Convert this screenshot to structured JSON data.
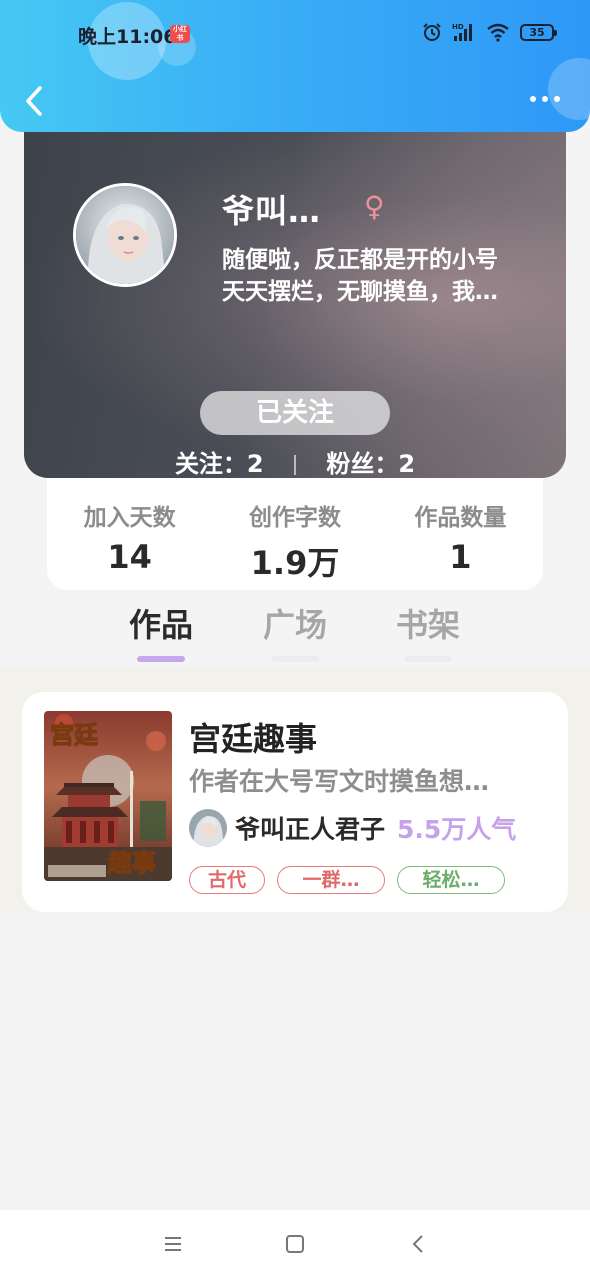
{
  "status_bar": {
    "time": "晚上11:06",
    "app_badge": "小红书",
    "battery": "35",
    "icons": [
      "alarm-icon",
      "signal-icon",
      "wifi-icon",
      "battery-icon"
    ]
  },
  "nav": {
    "back_icon": "chevron-left-icon",
    "more_icon": "more-horizontal-icon"
  },
  "profile": {
    "name": "爷叫…",
    "gender_symbol": "♀",
    "bio_line1": "随便啦，反正都是开的小号",
    "bio_line2": "天天摆烂，无聊摸鱼，我…",
    "follow_button": "已关注",
    "following_label": "关注：2",
    "followers_label": "粉丝：2"
  },
  "stats": [
    {
      "label": "加入天数",
      "value": "14"
    },
    {
      "label": "创作字数",
      "value": "1.9万"
    },
    {
      "label": "作品数量",
      "value": "1"
    }
  ],
  "tabs": [
    {
      "label": "作品",
      "active": true
    },
    {
      "label": "广场",
      "active": false
    },
    {
      "label": "书架",
      "active": false
    }
  ],
  "works": [
    {
      "title": "宫廷趣事",
      "description": "作者在大号写文时摸鱼想…",
      "author": "爷叫正人君子",
      "popularity": "5.5万人气",
      "cover_text_top": "宫廷",
      "cover_text_bottom": "趣事",
      "tags": [
        {
          "label": "古代",
          "color": "red"
        },
        {
          "label": "一群…",
          "color": "red"
        },
        {
          "label": "轻松…",
          "color": "green"
        }
      ]
    }
  ],
  "colors": {
    "header_gradient_start": "#45c9f3",
    "header_gradient_end": "#2e98f7",
    "tab_indicator": "#c7a7ec",
    "popularity": "#c6a2ea",
    "tag_red": "#e06a6a",
    "tag_green": "#6aae6a"
  },
  "system_nav": {
    "icons": [
      "menu-icon",
      "home-square-icon",
      "back-triangle-icon"
    ]
  }
}
